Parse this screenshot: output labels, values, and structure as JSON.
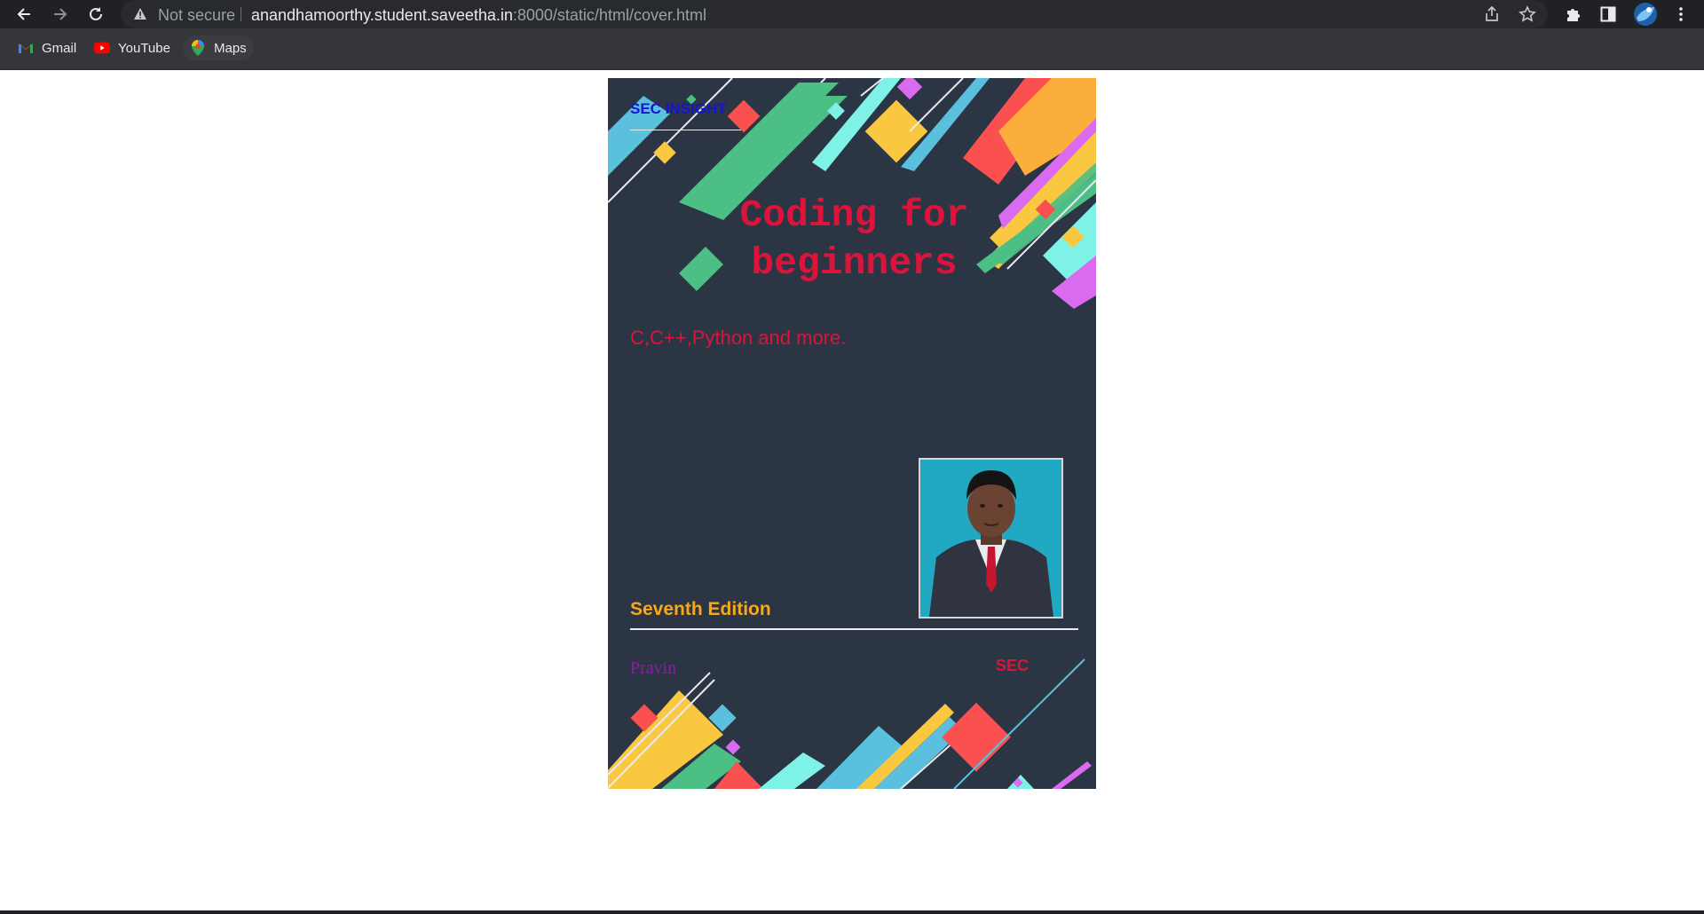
{
  "browser": {
    "security_label": "Not secure",
    "url_host": "anandhamoorthy.student.saveetha.in",
    "url_path": ":8000/static/html/cover.html",
    "icons": [
      "back-arrow-icon",
      "forward-arrow-icon",
      "reload-icon",
      "warning-icon",
      "share-icon",
      "star-icon",
      "extensions-puzzle-icon",
      "side-panel-icon",
      "profile-avatar-icon",
      "more-vert-icon"
    ],
    "bookmarks": [
      {
        "label": "Gmail",
        "icon": "gmail-icon"
      },
      {
        "label": "YouTube",
        "icon": "youtube-icon"
      },
      {
        "label": "Maps",
        "icon": "maps-icon"
      }
    ]
  },
  "cover": {
    "brand": "SEC INSIGHT",
    "title": "Coding for beginners",
    "subtitle": "C,C++,Python and more.",
    "edition": "Seventh Edition",
    "author": "Pravin",
    "publisher": "SEC",
    "photo": "author-portrait-photo",
    "colors": {
      "background": "#2c3544",
      "title": "#dc143c",
      "brand": "#1413d6",
      "edition": "#f5a91b",
      "author": "#8a1da6"
    }
  }
}
